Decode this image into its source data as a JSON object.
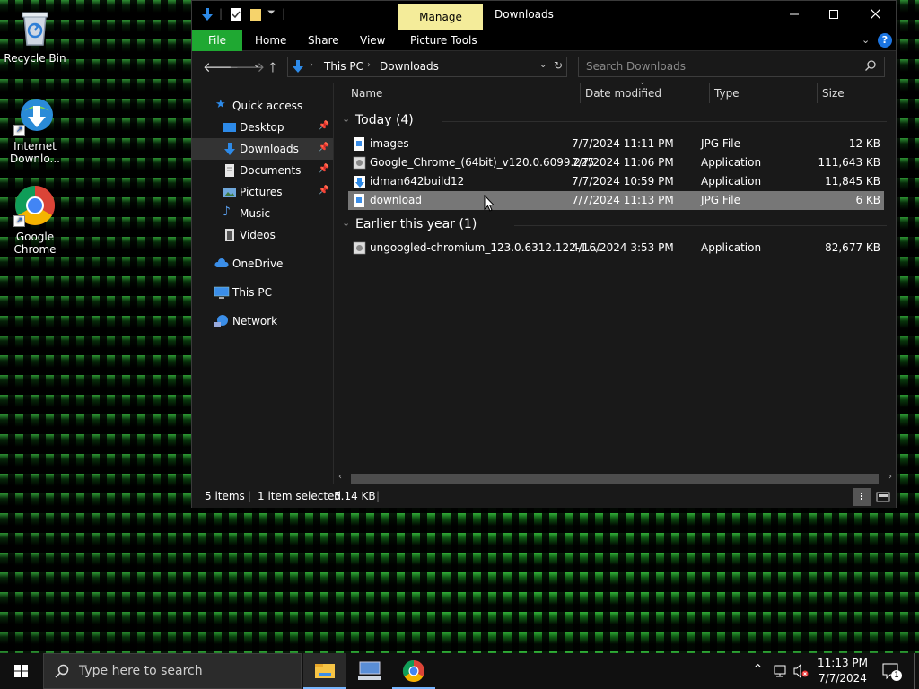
{
  "desktop": {
    "icons": [
      {
        "label": "Recycle Bin"
      },
      {
        "label": "Internet Downlo..."
      },
      {
        "label": "Google Chrome"
      }
    ]
  },
  "window": {
    "manage_tab": "Manage",
    "title": "Downloads",
    "ribbon_tabs": [
      "File",
      "Home",
      "Share",
      "View",
      "Picture Tools"
    ],
    "help": "?"
  },
  "address": {
    "crumbs": [
      "This PC",
      "Downloads"
    ],
    "search_placeholder": "Search Downloads"
  },
  "nav": {
    "items": [
      {
        "label": "Quick access"
      },
      {
        "label": "Desktop"
      },
      {
        "label": "Downloads"
      },
      {
        "label": "Documents"
      },
      {
        "label": "Pictures"
      },
      {
        "label": "Music"
      },
      {
        "label": "Videos"
      },
      {
        "label": "OneDrive"
      },
      {
        "label": "This PC"
      },
      {
        "label": "Network"
      }
    ]
  },
  "columns": {
    "name": "Name",
    "date": "Date modified",
    "type": "Type",
    "size": "Size"
  },
  "groups": [
    {
      "title": "Today (4)",
      "rows": [
        {
          "name": "images",
          "date": "7/7/2024 11:11 PM",
          "type": "JPG File",
          "size": "12 KB"
        },
        {
          "name": "Google_Chrome_(64bit)_v120.0.6099.225",
          "date": "7/7/2024 11:06 PM",
          "type": "Application",
          "size": "111,643 KB"
        },
        {
          "name": "idman642build12",
          "date": "7/7/2024 10:59 PM",
          "type": "Application",
          "size": "11,845 KB"
        },
        {
          "name": "download",
          "date": "7/7/2024 11:13 PM",
          "type": "JPG File",
          "size": "6 KB"
        }
      ]
    },
    {
      "title": "Earlier this year (1)",
      "rows": [
        {
          "name": "ungoogled-chromium_123.0.6312.122-1....",
          "date": "4/16/2024 3:53 PM",
          "type": "Application",
          "size": "82,677 KB"
        }
      ]
    }
  ],
  "status": {
    "items": "5 items",
    "selected": "1 item selected",
    "size": "5.14 KB"
  },
  "taskbar": {
    "search_placeholder": "Type here to search",
    "time": "11:13 PM",
    "date": "7/7/2024",
    "notifications": "1"
  },
  "colors": {
    "accent": "#1fa832",
    "manage": "#f4ec9a",
    "selection": "#777777"
  }
}
